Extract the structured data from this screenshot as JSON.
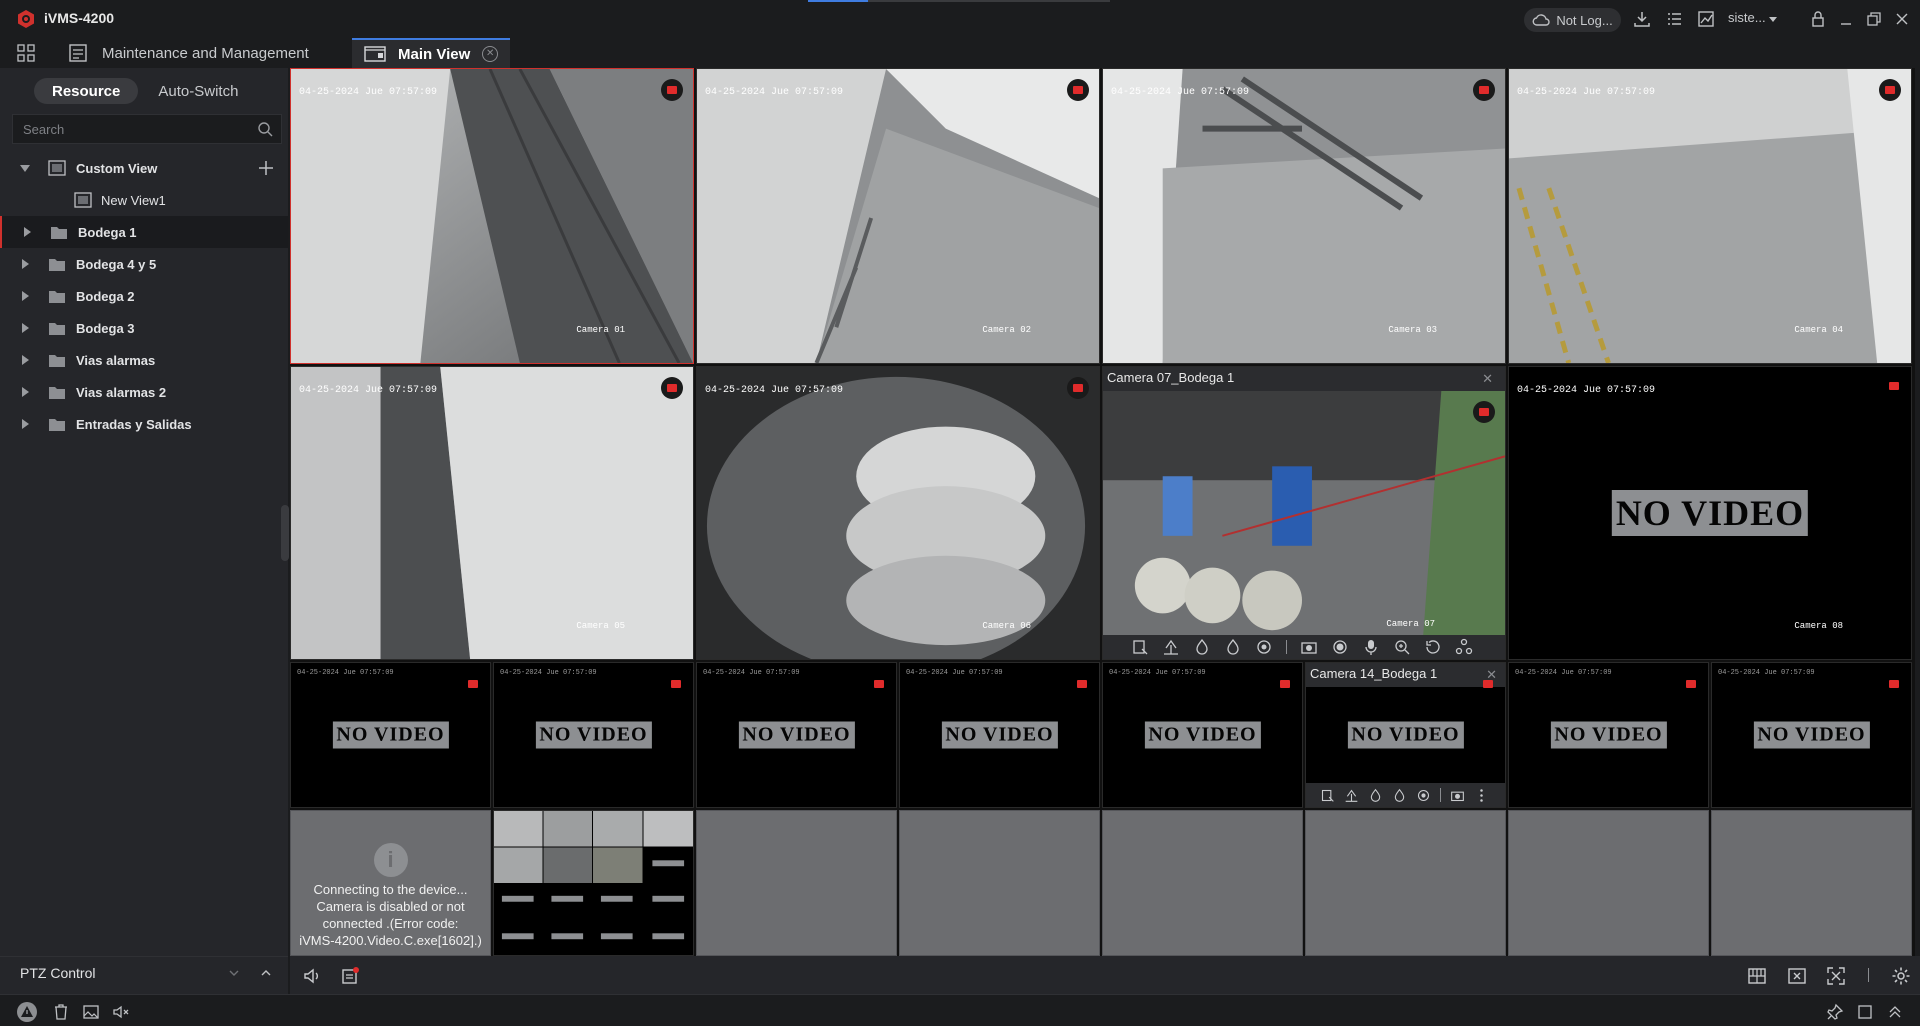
{
  "app": {
    "title": "iVMS-4200",
    "brand_color": "#d0312d",
    "accent": "#3f7ce0"
  },
  "titlebar": {
    "login_status": "Not Log...",
    "user": "siste...",
    "icons": [
      "cloud-icon",
      "download-icon",
      "task-list-icon",
      "chart-icon",
      "user-dropdown-icon",
      "lock-icon",
      "minimize-icon",
      "restore-icon",
      "close-icon"
    ]
  },
  "tabs": [
    {
      "label": "Maintenance and Management",
      "icon": "maintenance-icon",
      "active": false
    },
    {
      "label": "Main View",
      "icon": "main-view-icon",
      "active": true
    }
  ],
  "sidebar": {
    "resource_tab": "Resource",
    "autoswitch_tab": "Auto-Switch",
    "search_placeholder": "Search",
    "tree": {
      "custom_view": "Custom View",
      "new_view": "New View1",
      "groups": [
        "Bodega 1",
        "Bodega 4 y 5",
        "Bodega 2",
        "Bodega 3",
        "Vias alarmas",
        "Vias alarmas 2",
        "Entradas y Salidas"
      ],
      "selected": "Bodega 1"
    },
    "ptz_label": "PTZ Control"
  },
  "cameras": {
    "timestamp": "04-25-2024 Jue 07:57:09",
    "c1": {
      "name": "Camera 01"
    },
    "c2": {
      "name": "Camera 02"
    },
    "c3": {
      "name": "Camera 03"
    },
    "c4": {
      "name": "Camera 04"
    },
    "c5": {
      "name": "Camera 05"
    },
    "c6": {
      "name": "Camera 06"
    },
    "c7": {
      "name": "Camera 07",
      "title": "Camera 07_Bodega 1"
    },
    "c8": {
      "name": "Camera 08"
    },
    "c14": {
      "title": "Camera 14_Bodega 1"
    },
    "novideo": "NO VIDEO",
    "small_ts": "04-25-2024 Jue 07:57:09"
  },
  "error": {
    "line1": "Connecting to the device...",
    "line2": "Camera is disabled or not",
    "line3": "connected .(Error code:",
    "line4": "iVMS-4200.Video.C.exe[1602].)"
  },
  "bottombar": {
    "icons": [
      "volume-icon",
      "record-icon",
      "layout-icon",
      "clear-icon",
      "fullscreen-icon",
      "settings-icon"
    ]
  },
  "statusbar": {
    "icons": [
      "alarm-icon",
      "delete-icon",
      "image-icon",
      "mute-icon",
      "pin-icon",
      "maximize-icon",
      "expand-up-icon"
    ]
  }
}
